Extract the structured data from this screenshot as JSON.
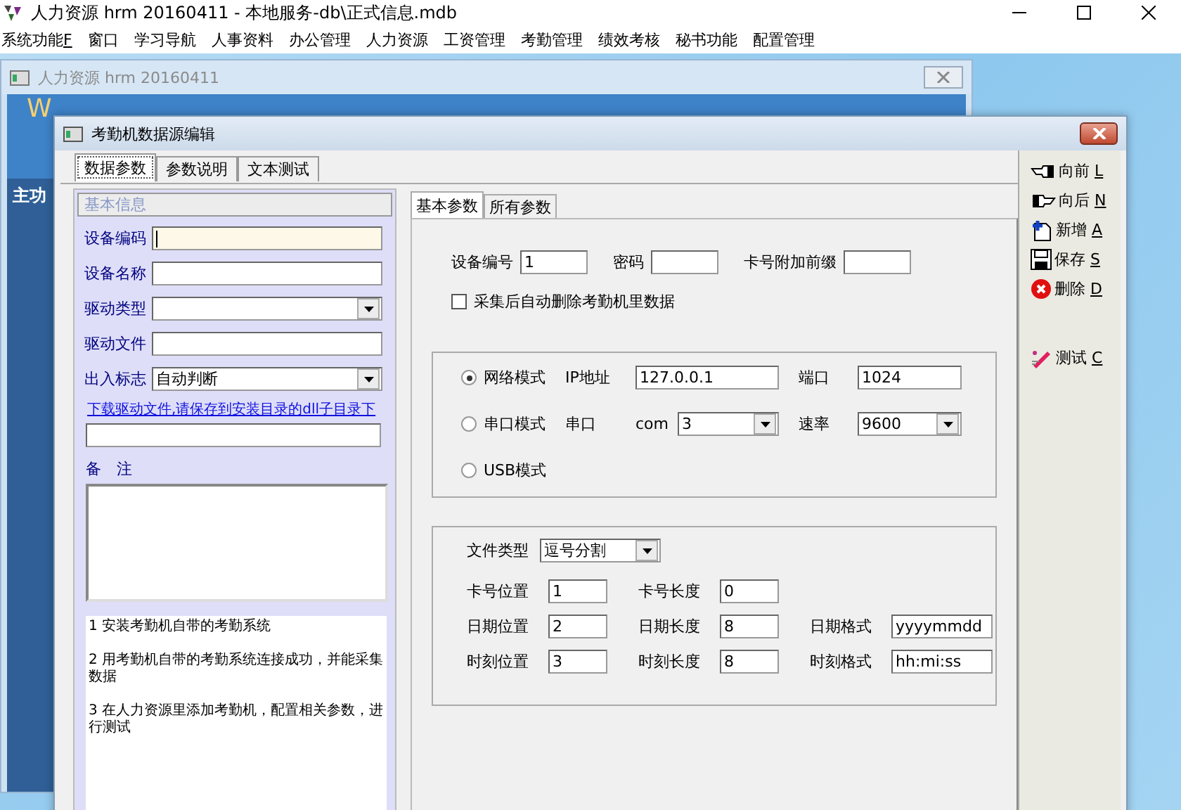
{
  "app": {
    "title": "人力资源 hrm 20160411 - 本地服务-db\\正式信息.mdb"
  },
  "menu": [
    {
      "label": "系统功能",
      "shortcut": "F"
    },
    {
      "label": "窗口"
    },
    {
      "label": "学习导航"
    },
    {
      "label": "人事资料"
    },
    {
      "label": "办公管理"
    },
    {
      "label": "人力资源"
    },
    {
      "label": "工资管理"
    },
    {
      "label": "考勤管理"
    },
    {
      "label": "绩效考核"
    },
    {
      "label": "秘书功能"
    },
    {
      "label": "配置管理"
    }
  ],
  "background_window": {
    "title": "人力资源 hrm 20160411",
    "banner_text": "W",
    "side_text": "主功"
  },
  "dialog": {
    "title": "考勤机数据源编辑",
    "tabs": [
      {
        "label": "数据参数",
        "selected": true
      },
      {
        "label": "参数说明",
        "selected": false
      },
      {
        "label": "文本测试",
        "selected": false
      }
    ],
    "left": {
      "section": "基本信息",
      "fields": [
        {
          "kind": "text",
          "label": "设备编码",
          "focused": true
        },
        {
          "kind": "text",
          "label": "设备名称",
          "focused": false
        },
        {
          "kind": "select",
          "label": "驱动类型",
          "focused": false
        },
        {
          "kind": "text",
          "label": "驱动文件",
          "focused": false
        },
        {
          "kind": "select",
          "label": "出入标志",
          "value": "自动判断",
          "focused": false
        }
      ],
      "link": "下载驱动文件,请保存到安装目录的dll子目录下",
      "remark_label": "备　注",
      "notes": [
        "1 安装考勤机自带的考勤系统",
        "2 用考勤机自带的考勤系统连接成功，并能采集数据",
        "3 在人力资源里添加考勤机，配置相关参数，进行测试"
      ]
    },
    "right": {
      "tabs": [
        {
          "label": "基本参数",
          "selected": true
        },
        {
          "label": "所有参数",
          "selected": false
        }
      ],
      "top_fields": [
        {
          "label": "设备编号",
          "value": "1"
        },
        {
          "label": "密码"
        },
        {
          "label": "卡号附加前缀"
        }
      ],
      "auto_delete": {
        "label": "采集后自动删除考勤机里数据",
        "checked": false
      },
      "modes": [
        {
          "kind": "network",
          "label": "网络模式",
          "selected": true,
          "address_label": "IP地址",
          "address": "127.0.0.1",
          "port_label": "端口",
          "port": "1024"
        },
        {
          "kind": "serial",
          "label": "串口模式",
          "selected": false,
          "port_label": "串口",
          "com_label": "com",
          "com": "3",
          "rate_label": "速率",
          "rate": "9600"
        },
        {
          "kind": "usb",
          "label": "USB模式",
          "selected": false
        }
      ],
      "file_type": {
        "label": "文件类型",
        "value": "逗号分割"
      },
      "format_rows": [
        [
          {
            "label": "卡号位置",
            "value": "1"
          },
          {
            "label": "卡号长度",
            "value": "0"
          }
        ],
        [
          {
            "label": "日期位置",
            "value": "2"
          },
          {
            "label": "日期长度",
            "value": "8"
          },
          {
            "label": "日期格式",
            "value": "yyyymmdd"
          }
        ],
        [
          {
            "label": "时刻位置",
            "value": "3"
          },
          {
            "label": "时刻长度",
            "value": "8"
          },
          {
            "label": "时刻格式",
            "value": "hh:mi:ss"
          }
        ]
      ]
    },
    "toolbar": [
      {
        "label": "向前",
        "shortcut": "L"
      },
      {
        "label": "向后",
        "shortcut": "N"
      },
      {
        "label": "新增",
        "shortcut": "A"
      },
      {
        "label": "保存",
        "shortcut": "S"
      },
      {
        "label": "删除",
        "shortcut": "D"
      },
      {
        "label": "测试",
        "shortcut": "C"
      }
    ]
  }
}
